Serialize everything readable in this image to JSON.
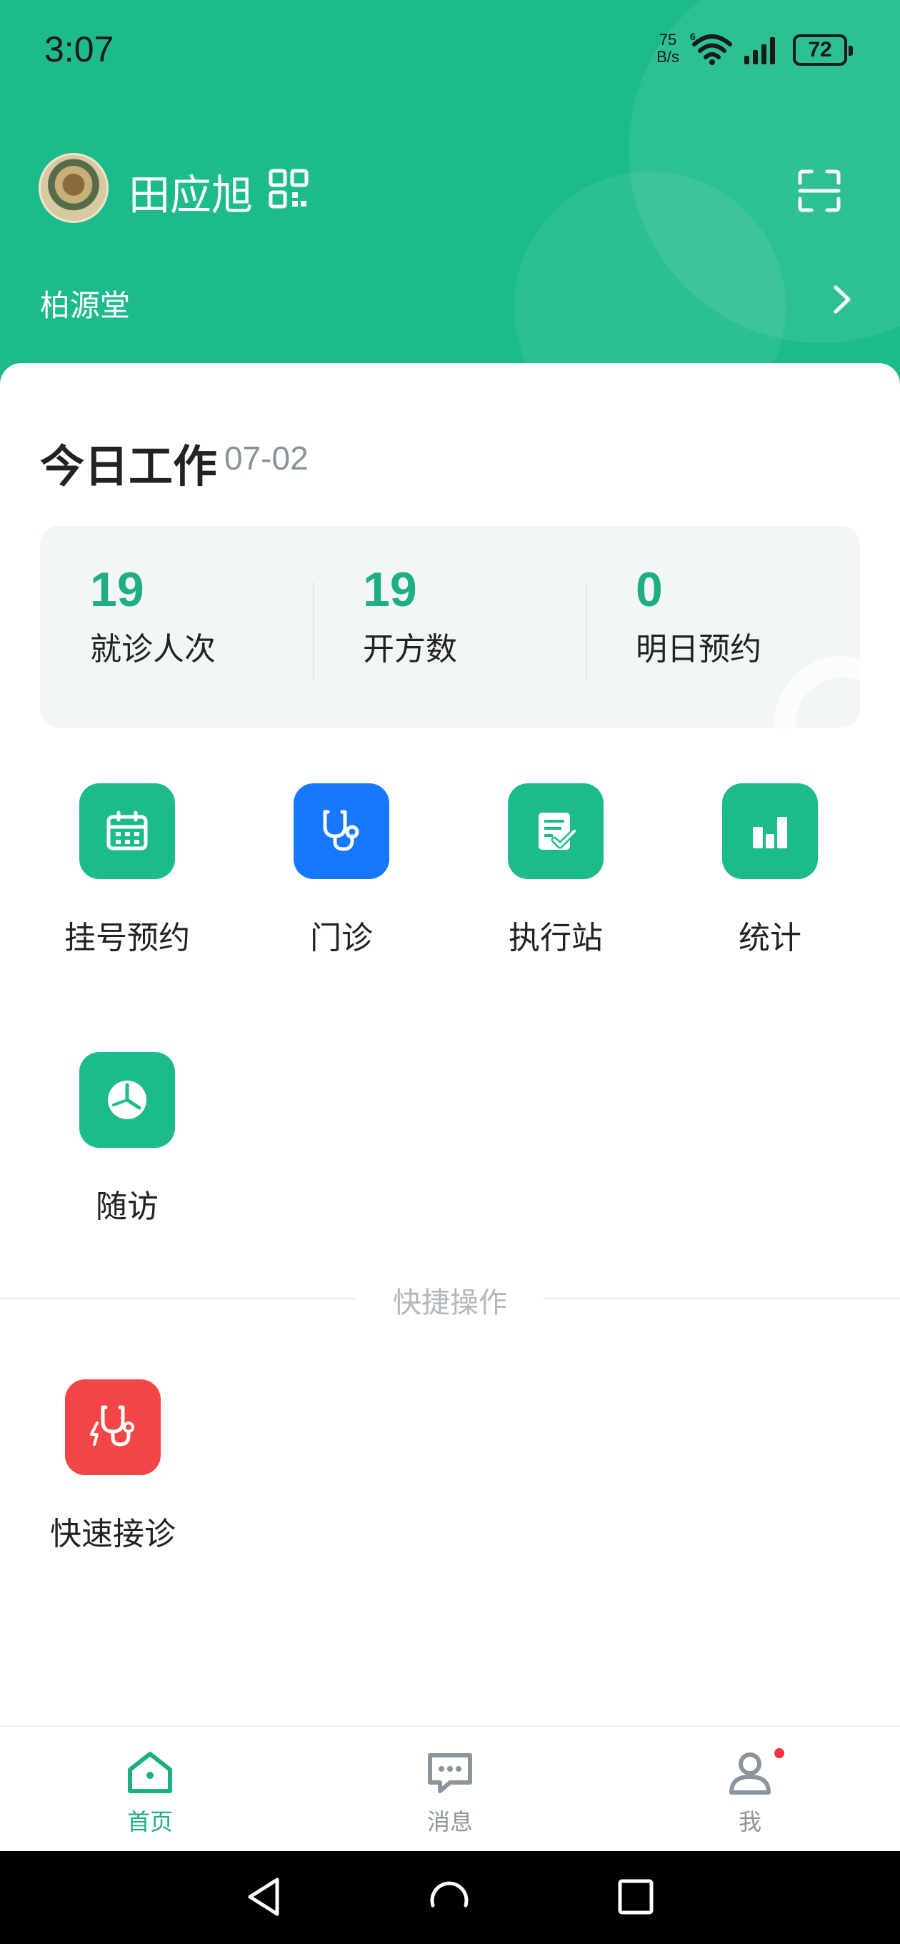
{
  "status_bar": {
    "time": "3:07",
    "net_speed_value": "75",
    "net_speed_unit": "B/s",
    "battery": "72",
    "wifi_icon": "wifi-6-icon",
    "signal_icon": "signal-icon"
  },
  "header": {
    "user_name": "田应旭",
    "clinic_name": "柏源堂",
    "qr_icon": "qr-code-icon",
    "scan_icon": "scan-icon",
    "accent_color": "#1dbb8c"
  },
  "today": {
    "title": "今日工作",
    "date": "07-02",
    "stats": [
      {
        "value": "19",
        "label": "就诊人次"
      },
      {
        "value": "19",
        "label": "开方数"
      },
      {
        "value": "0",
        "label": "明日预约"
      }
    ]
  },
  "functions": [
    {
      "label": "挂号预约",
      "icon": "calendar-icon",
      "color": "#1dbb8c"
    },
    {
      "label": "门诊",
      "icon": "stethoscope-icon",
      "color": "#1677ff"
    },
    {
      "label": "执行站",
      "icon": "task-check-icon",
      "color": "#1dbb8c"
    },
    {
      "label": "统计",
      "icon": "bar-chart-icon",
      "color": "#1dbb8c"
    },
    {
      "label": "随访",
      "icon": "clock-pie-icon",
      "color": "#1dbb8c"
    }
  ],
  "quick_actions": {
    "title": "快捷操作",
    "items": [
      {
        "label": "快速接诊",
        "icon": "quick-stethoscope-icon",
        "color": "#f24545"
      }
    ]
  },
  "bottom_nav": [
    {
      "label": "首页",
      "icon": "home-icon",
      "active": true
    },
    {
      "label": "消息",
      "icon": "message-icon",
      "active": false
    },
    {
      "label": "我",
      "icon": "user-icon",
      "active": false,
      "badge": true
    }
  ]
}
